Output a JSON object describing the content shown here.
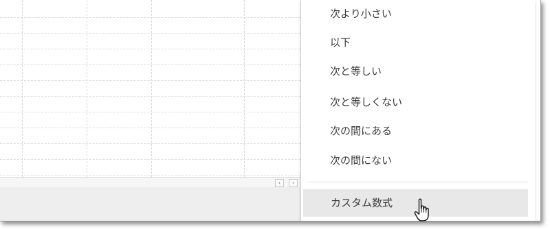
{
  "menu": {
    "items": [
      {
        "label": "次より小さい"
      },
      {
        "label": "以下"
      },
      {
        "label": "次と等しい"
      },
      {
        "label": "次と等しくない"
      },
      {
        "label": "次の間にある"
      },
      {
        "label": "次の間にない"
      }
    ],
    "custom_formula": {
      "label": "カスタム数式",
      "state": "hover"
    }
  },
  "scrollbar": {
    "left_arrow": "‹",
    "right_arrow": "›"
  },
  "colors": {
    "menu_hover": "#e8e8e8",
    "grid_line": "#d6d6d6",
    "sheet_bar": "#eeeeee",
    "text": "#3c3c3c"
  },
  "icons": {
    "cursor": "hand-pointer-icon"
  }
}
